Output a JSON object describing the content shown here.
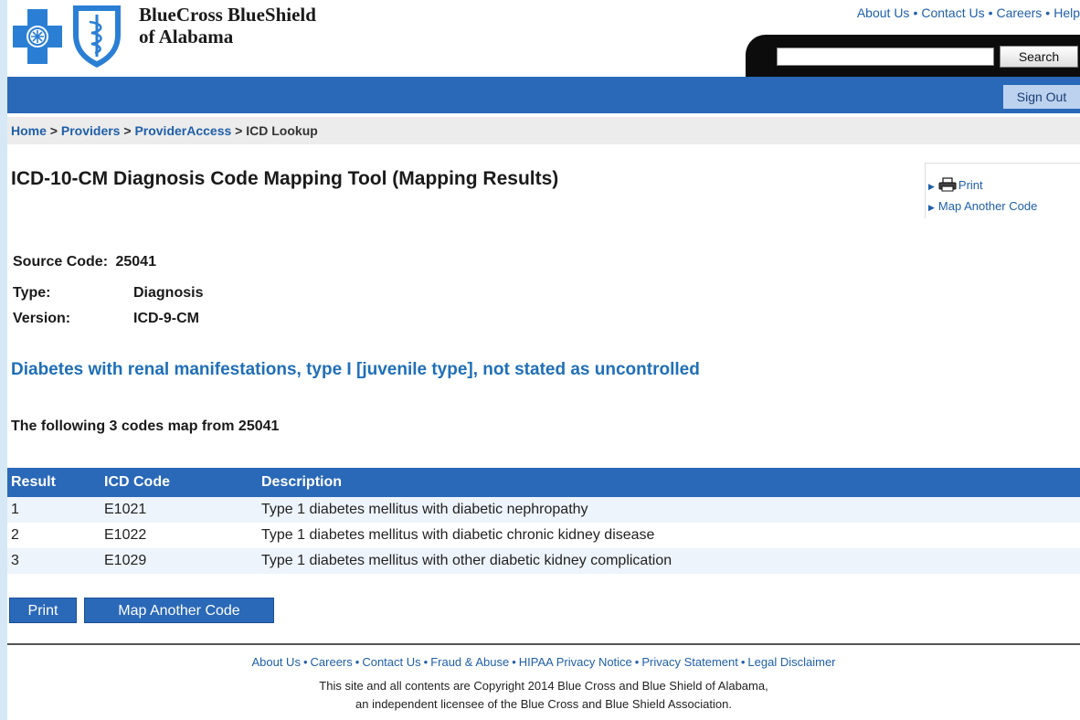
{
  "brand": {
    "name": "BlueCross BlueShield",
    "sub": "of Alabama"
  },
  "top_links": [
    "About Us",
    "Contact Us",
    "Careers",
    "Help"
  ],
  "search": {
    "button_label": "Search",
    "value": ""
  },
  "signout_label": "Sign Out",
  "breadcrumb": {
    "home": "Home",
    "providers": "Providers",
    "provideraccess": "ProviderAccess",
    "current": "ICD Lookup",
    "sep": " > "
  },
  "page_title": "ICD-10-CM Diagnosis Code Mapping Tool (Mapping Results)",
  "side_links": {
    "print": "Print",
    "map_another": "Map Another Code"
  },
  "meta": {
    "source_label": "Source Code:",
    "source_value": "25041",
    "type_label": "Type:",
    "type_value": "Diagnosis",
    "version_label": "Version:",
    "version_value": "ICD-9-CM"
  },
  "description": "Diabetes with renal manifestations, type I [juvenile type], not stated as uncontrolled",
  "mapping_line": "The following 3 codes map from 25041",
  "table": {
    "headers": [
      "Result",
      "ICD Code",
      "Description"
    ],
    "rows": [
      [
        "1",
        "E1021",
        "Type 1 diabetes mellitus with diabetic nephropathy"
      ],
      [
        "2",
        "E1022",
        "Type 1 diabetes mellitus with diabetic chronic kidney disease"
      ],
      [
        "3",
        "E1029",
        "Type 1 diabetes mellitus with other diabetic kidney complication"
      ]
    ]
  },
  "buttons": {
    "print": "Print",
    "map_another": "Map Another Code"
  },
  "footer": {
    "links": [
      "About Us",
      "Careers",
      "Contact Us",
      "Fraud & Abuse",
      "HIPAA Privacy Notice",
      "Privacy Statement",
      "Legal Disclaimer"
    ],
    "copyright_line1": "This site and all contents are Copyright 2014 Blue Cross and Blue Shield of Alabama,",
    "copyright_line2": "an independent licensee of the Blue Cross and Blue Shield Association."
  },
  "colors": {
    "brand_blue": "#2a68b8",
    "link_blue": "#1f5faa",
    "desc_blue": "#1f6fb8"
  }
}
